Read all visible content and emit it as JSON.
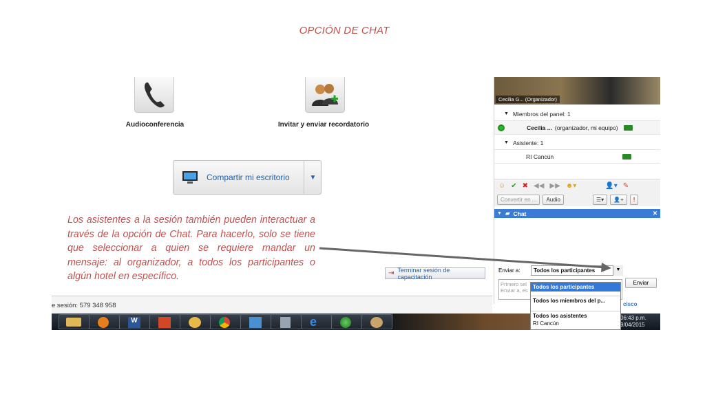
{
  "slide": {
    "title": "OPCIÓN DE CHAT",
    "caption": "Los asistentes a la sesión también pueden interactuar a través de la opción de Chat. Para hacerlo, solo se tiene que seleccionar a quien se requiere  mandar un mensaje: al organizador, a todos los participantes o algún hotel en específico."
  },
  "main": {
    "audio_label": "Audioconferencia",
    "invite_label": "Invitar y enviar recordatorio",
    "share_label": "Compartir mi escritorio",
    "end_session_label": "Terminar sesión de capacitación",
    "session_text": "e sesión: 579 348 958"
  },
  "panel": {
    "video_label": "Cecilia G... (Organizador)",
    "panel_members_header": "Miembros del panel: 1",
    "panel_member_name": "Cecilia ...",
    "panel_member_role": "(organizador, mi equipo)",
    "attendees_header": "Asistente: 1",
    "attendee_name": "RI Cancún",
    "convert_label": "Convertir en ...",
    "audio_btn": "Audio",
    "chat_title": "Chat",
    "send_to_label": "Enviar a:",
    "send_to_value": "Todos los participantes",
    "message_placeholder_1": "Primero sel",
    "message_placeholder_2": "Enviar a, es",
    "send_button": "Enviar"
  },
  "dropdown_options": [
    "Todos los participantes",
    "Todos los miembros del p...",
    "Todos los asistentes",
    "RI Cancún"
  ],
  "tray": {
    "time": "06:43 p.m.",
    "date": "9/04/2015",
    "brand": "cisco"
  },
  "colors": {
    "accent_text": "#c0504d",
    "chat_header": "#3a7bd5",
    "link_blue": "#1f5fa8"
  }
}
